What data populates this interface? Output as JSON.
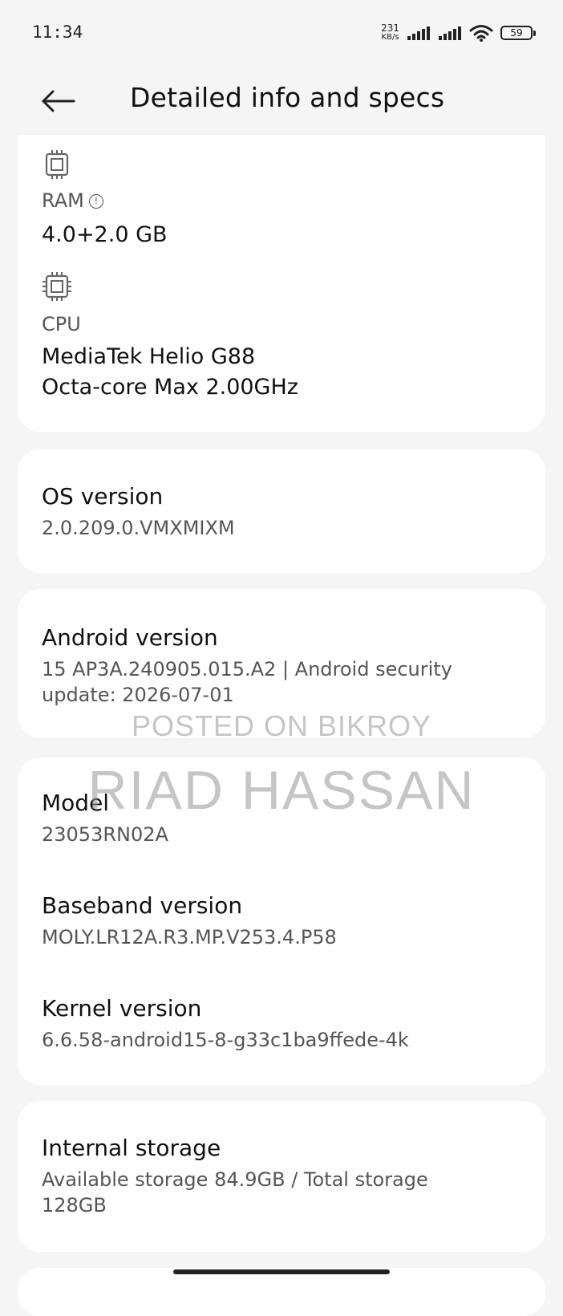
{
  "status": {
    "time": "11:34",
    "netspeed_value": "231",
    "netspeed_unit": "KB/s",
    "battery": "59"
  },
  "header": {
    "title": "Detailed info and specs"
  },
  "hardware": {
    "ram_label": "RAM",
    "ram_value": "4.0+2.0 GB",
    "cpu_label": "CPU",
    "cpu_line1": "MediaTek Helio G88",
    "cpu_line2": "Octa-core Max 2.00GHz"
  },
  "os": {
    "title": "OS version",
    "value": "2.0.209.0.VMXMIXM"
  },
  "android": {
    "title": "Android version",
    "line1": "15 AP3A.240905.015.A2 | Android security",
    "line2": "update: 2026-07-01"
  },
  "device": {
    "model_title": "Model",
    "model_value": "23053RN02A",
    "baseband_title": "Baseband version",
    "baseband_value": "MOLY.LR12A.R3.MP.V253.4.P58",
    "kernel_title": "Kernel version",
    "kernel_value": "6.6.58-android15-8-g33c1ba9ffede-4k"
  },
  "storage": {
    "title": "Internal storage",
    "line1": "Available storage  84.9GB / Total storage",
    "line2": "128GB"
  },
  "watermark": {
    "line1": "POSTED ON BIKROY",
    "line2": "RIAD HASSAN"
  }
}
